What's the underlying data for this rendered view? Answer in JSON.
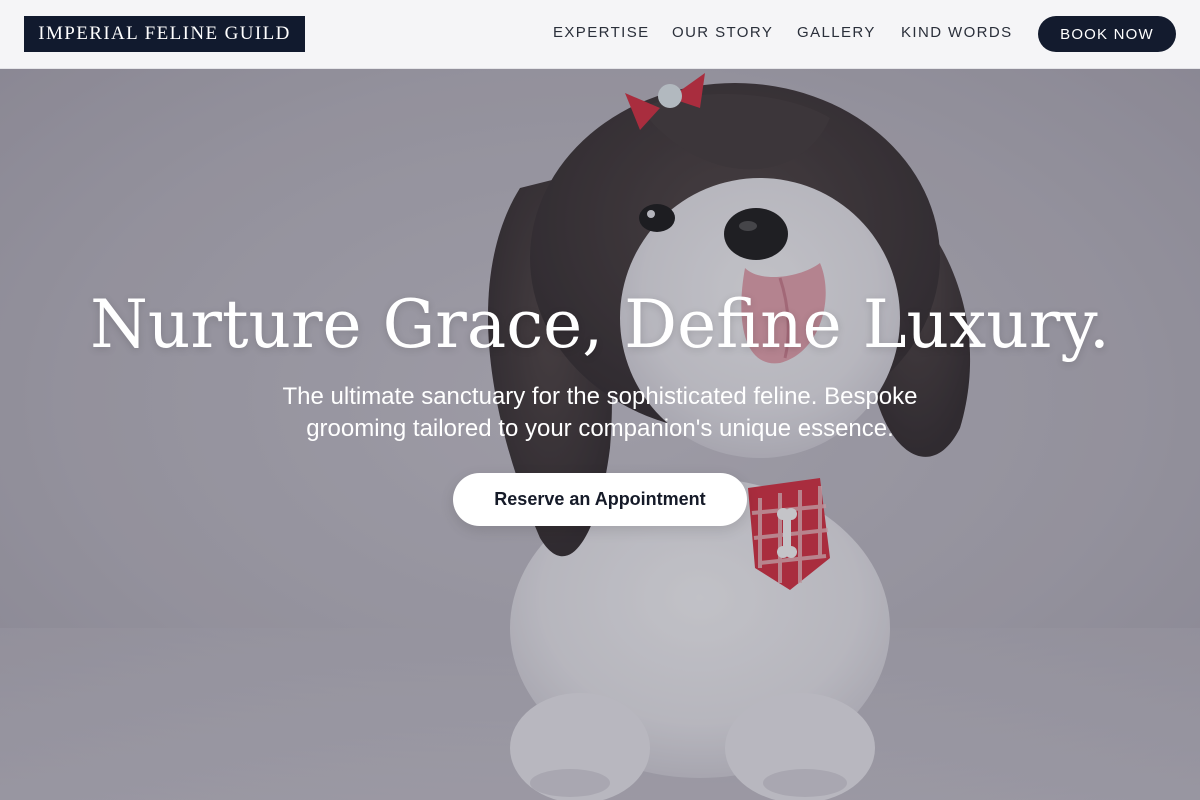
{
  "brand": {
    "name": "IMPERIAL FELINE GUILD"
  },
  "nav": {
    "links": [
      "EXPERTISE",
      "OUR STORY",
      "GALLERY",
      "KIND WORDS"
    ],
    "cta_label": "BOOK NOW"
  },
  "hero": {
    "title": "Nurture Grace, Define Luxury.",
    "subtitle": "The ultimate sanctuary for the sophisticated feline. Bespoke grooming tailored to your companion's unique essence.",
    "cta_label": "Reserve an Appointment",
    "background": "fluffy-dog-with-red-bow-and-tie-photo"
  },
  "colors": {
    "brand_navy": "#111a2e",
    "nav_text": "#2a2f3a",
    "hero_text": "#ffffff",
    "tie_red": "#d9283a"
  }
}
